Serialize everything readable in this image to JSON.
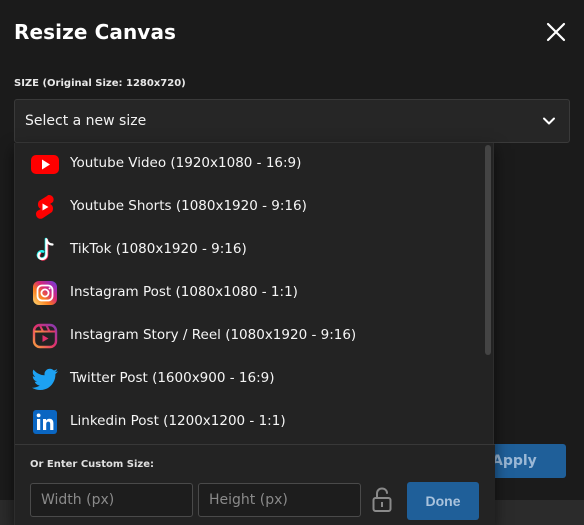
{
  "dialog": {
    "title": "Resize Canvas",
    "size_label": "SIZE (Original Size: 1280x720)",
    "select_placeholder": "Select a new size",
    "apply_label": "Apply"
  },
  "options": [
    {
      "label": "Youtube Video (1920x1080 - 16:9)",
      "icon": "youtube-icon",
      "color": "#ff0000"
    },
    {
      "label": "Youtube Shorts (1080x1920 - 9:16)",
      "icon": "youtube-shorts-icon",
      "color": "#ff0000"
    },
    {
      "label": "TikTok (1080x1920 - 9:16)",
      "icon": "tiktok-icon",
      "color": "#ffffff"
    },
    {
      "label": "Instagram Post (1080x1080 - 1:1)",
      "icon": "instagram-icon",
      "color": "#d6249f"
    },
    {
      "label": "Instagram Story / Reel (1080x1920 - 9:16)",
      "icon": "instagram-reel-icon",
      "color": "#e1306c"
    },
    {
      "label": "Twitter Post (1600x900 - 16:9)",
      "icon": "twitter-icon",
      "color": "#1da1f2"
    },
    {
      "label": "Linkedin Post (1200x1200 - 1:1)",
      "icon": "linkedin-icon",
      "color": "#0a66c2"
    }
  ],
  "custom": {
    "label": "Or Enter Custom Size:",
    "width_placeholder": "Width (px)",
    "height_placeholder": "Height (px)",
    "done_label": "Done"
  },
  "colors": {
    "accent": "#1f5f99",
    "background": "#1b1b1b"
  }
}
